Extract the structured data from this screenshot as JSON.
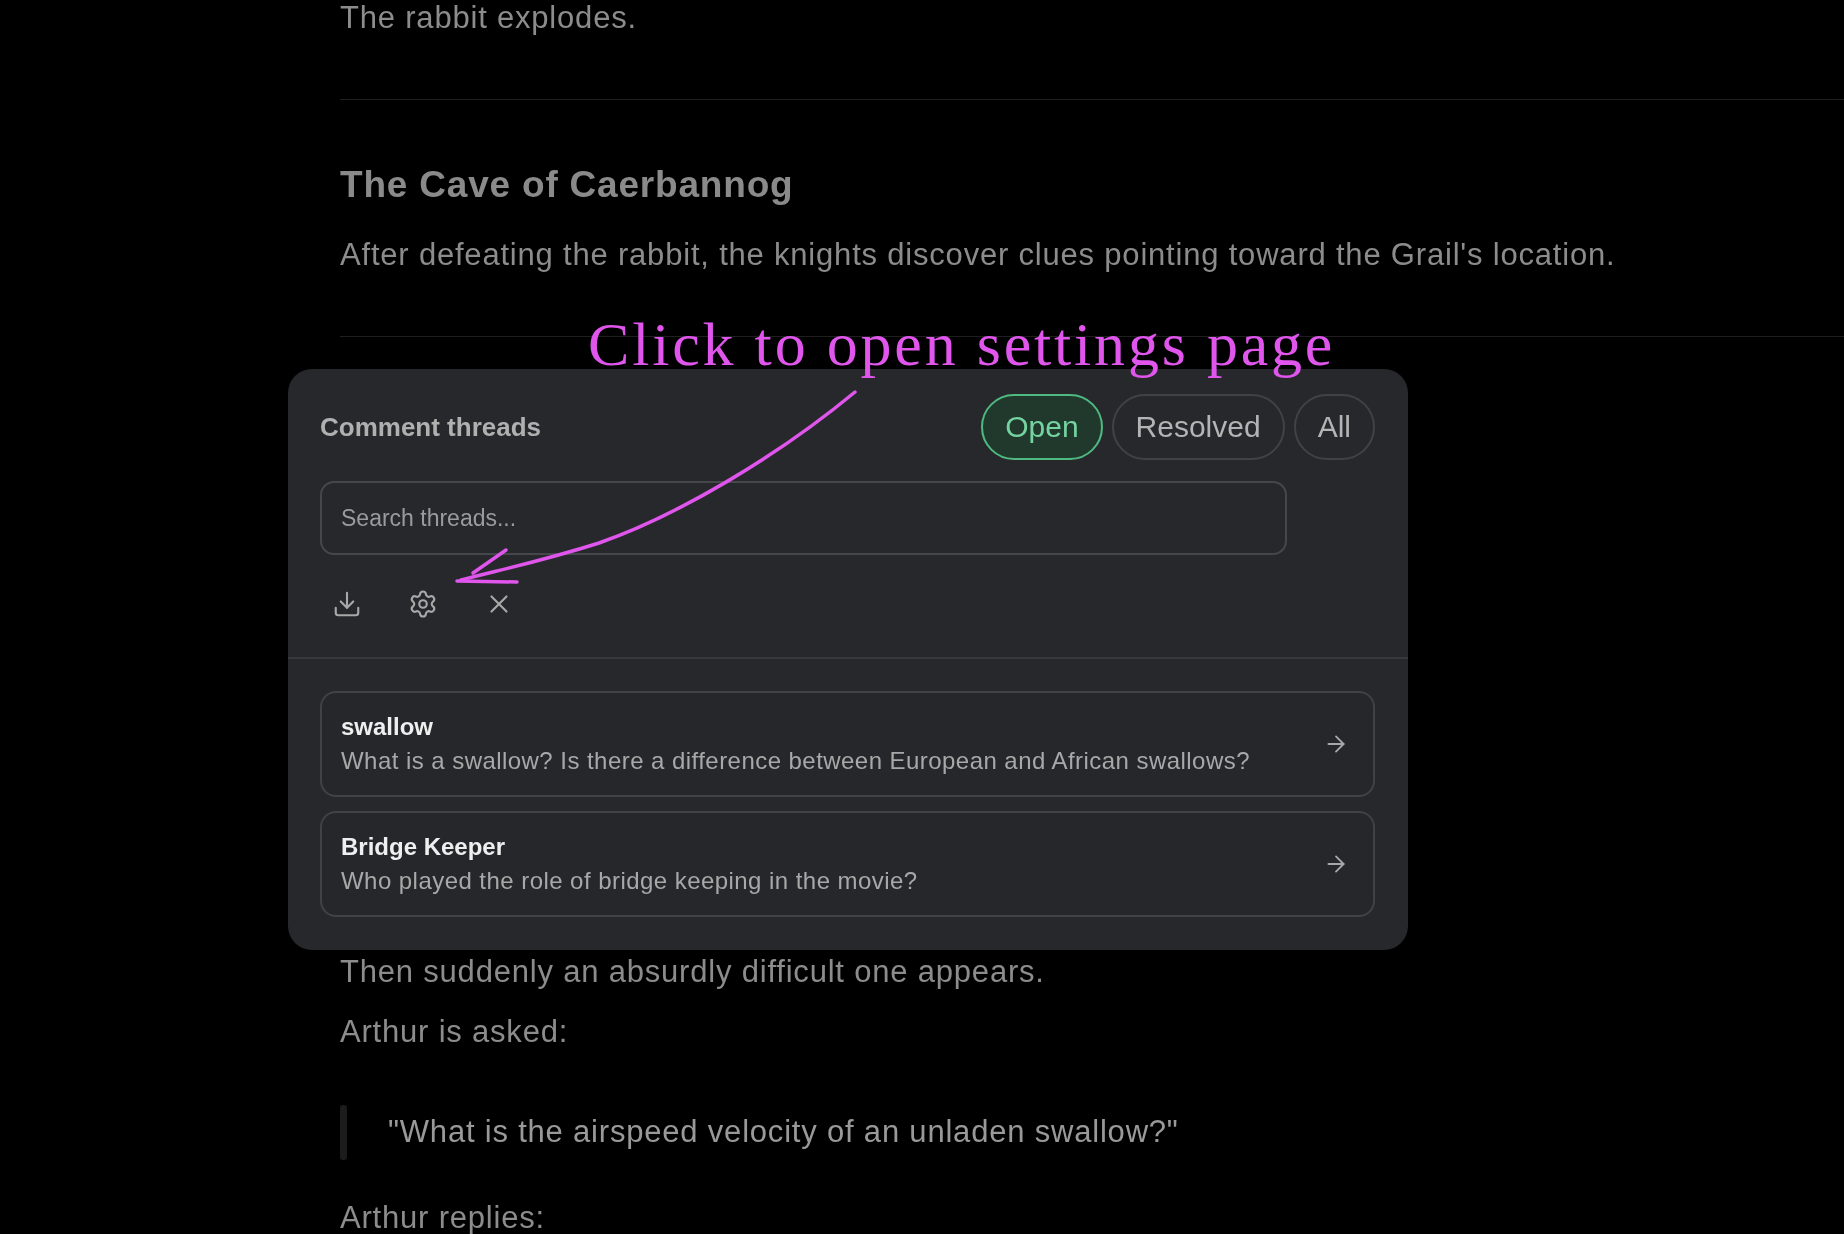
{
  "article_top": [
    {
      "kind": "paragraph",
      "text": "The rabbit explodes."
    },
    {
      "kind": "rule"
    },
    {
      "kind": "heading",
      "text": "The Cave of Caerbannog"
    },
    {
      "kind": "paragraph",
      "text": "After defeating the rabbit, the knights discover clues pointing toward the Grail's location."
    },
    {
      "kind": "rule"
    }
  ],
  "annotation": {
    "text": "Click to open settings page"
  },
  "comment_panel": {
    "title": "Comment threads",
    "filters": [
      {
        "label": "Open",
        "selected": true
      },
      {
        "label": "Resolved",
        "selected": false
      },
      {
        "label": "All",
        "selected": false
      }
    ],
    "search": {
      "placeholder": "Search threads..."
    },
    "threads": [
      {
        "title": "swallow",
        "body": "What is a swallow? Is there a difference between European and African swallows?"
      },
      {
        "title": "Bridge Keeper",
        "body": "Who played the role of bridge keeping in the movie?"
      }
    ]
  },
  "article_bottom": [
    {
      "kind": "paragraph",
      "text": "Then suddenly an absurdly difficult one appears."
    },
    {
      "kind": "paragraph",
      "text": "Arthur is asked:"
    },
    {
      "kind": "quote",
      "text": "\"What is the airspeed velocity of an unladen swallow?\""
    },
    {
      "kind": "paragraph",
      "text": "Arthur replies:"
    }
  ]
}
